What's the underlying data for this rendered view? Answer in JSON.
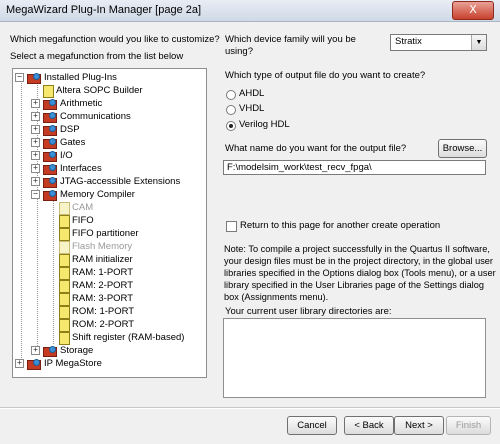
{
  "window": {
    "title": "MegaWizard Plug-In Manager [page 2a]",
    "close_label": "X"
  },
  "left": {
    "question": "Which megafunction would you like to customize?",
    "instruction": "Select a megafunction from the list below"
  },
  "tree": {
    "items": [
      {
        "label": "Installed Plug-Ins",
        "icon": "plugin-folder-icon"
      },
      {
        "label": "Altera SOPC Builder",
        "icon": "document-icon"
      },
      {
        "label": "Arithmetic",
        "icon": "plugin-folder-icon"
      },
      {
        "label": "Communications",
        "icon": "plugin-folder-icon"
      },
      {
        "label": "DSP",
        "icon": "plugin-folder-icon"
      },
      {
        "label": "Gates",
        "icon": "plugin-folder-icon"
      },
      {
        "label": "I/O",
        "icon": "plugin-folder-icon"
      },
      {
        "label": "Interfaces",
        "icon": "plugin-folder-icon"
      },
      {
        "label": "JTAG-accessible Extensions",
        "icon": "plugin-folder-icon"
      },
      {
        "label": "Memory Compiler",
        "icon": "plugin-folder-icon"
      },
      {
        "label": "CAM",
        "icon": "document-icon"
      },
      {
        "label": "FIFO",
        "icon": "document-icon"
      },
      {
        "label": "FIFO partitioner",
        "icon": "document-icon"
      },
      {
        "label": "Flash Memory",
        "icon": "document-icon"
      },
      {
        "label": "RAM initializer",
        "icon": "document-icon"
      },
      {
        "label": "RAM: 1-PORT",
        "icon": "document-icon"
      },
      {
        "label": "RAM: 2-PORT",
        "icon": "document-icon"
      },
      {
        "label": "RAM: 3-PORT",
        "icon": "document-icon"
      },
      {
        "label": "ROM: 1-PORT",
        "icon": "document-icon"
      },
      {
        "label": "ROM: 2-PORT",
        "icon": "document-icon"
      },
      {
        "label": "Shift register (RAM-based)",
        "icon": "document-icon"
      },
      {
        "label": "Storage",
        "icon": "plugin-folder-icon"
      },
      {
        "label": "IP MegaStore",
        "icon": "plugin-folder-icon"
      }
    ]
  },
  "device": {
    "question_line1": "Which device family will you be",
    "question_line2": "using?",
    "selected": "Stratix"
  },
  "output_type": {
    "question": "Which type of output file do you want to create?",
    "options": [
      "AHDL",
      "VHDL",
      "Verilog HDL"
    ],
    "selected": "Verilog HDL"
  },
  "output_name": {
    "question": "What name do you want for the output file?",
    "browse_label": "Browse...",
    "value": "F:\\modelsim_work\\test_recv_fpga\\"
  },
  "return_checkbox": {
    "label": "Return to this page for another create operation",
    "checked": false
  },
  "note": {
    "lines": [
      "Note: To compile a project successfully in the Quartus II software,",
      "your design files must be in the project directory, in the global user",
      "libraries specified in the Options dialog box (Tools menu), or a user",
      "library specified in the User Libraries page of the Settings dialog",
      "box (Assignments menu)."
    ]
  },
  "library": {
    "label": "Your current user library directories are:"
  },
  "buttons": {
    "cancel": "Cancel",
    "back": "< Back",
    "next": "Next >",
    "finish": "Finish"
  },
  "colors": {
    "folder_red": "#c23b22",
    "document_yellow": "#f6e76e",
    "close_red": "#c8412e"
  }
}
